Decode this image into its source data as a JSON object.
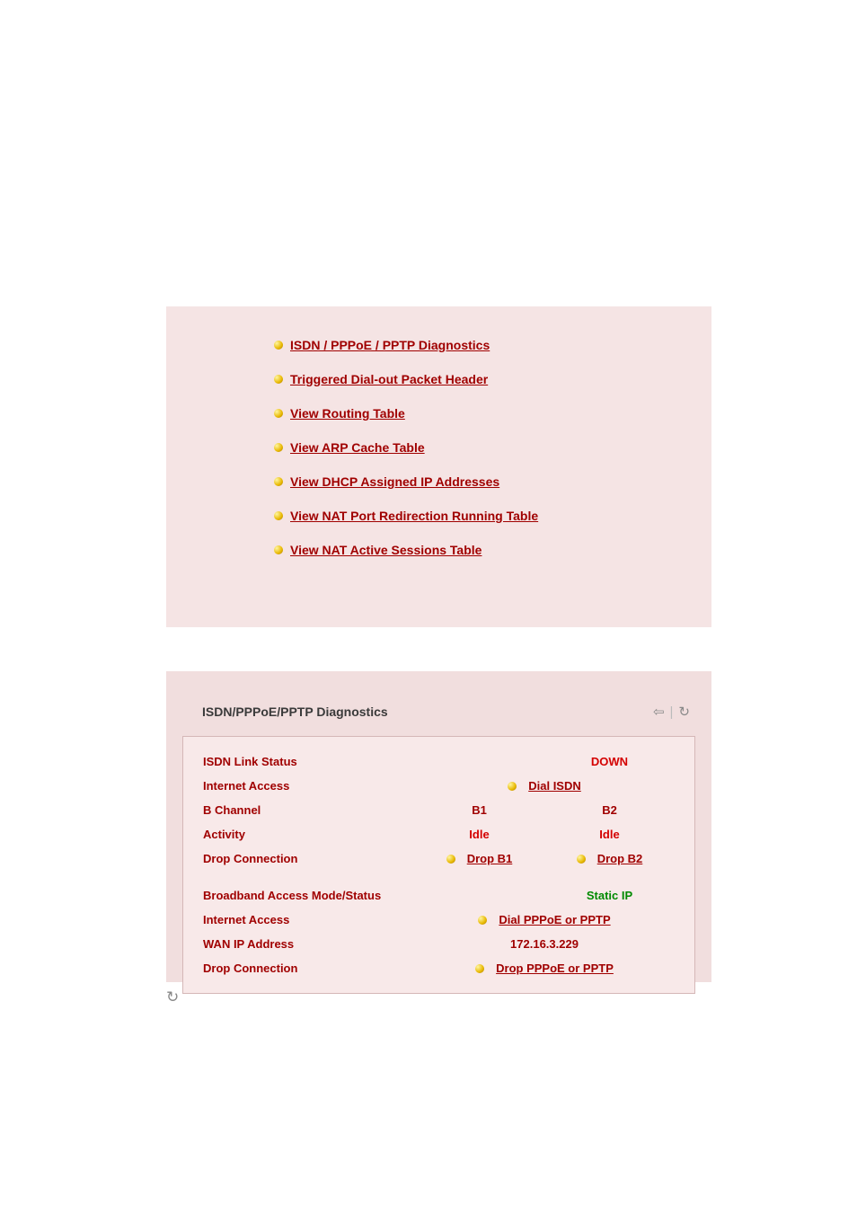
{
  "menu": {
    "items": [
      "ISDN / PPPoE / PPTP Diagnostics",
      "Triggered Dial-out Packet Header",
      "View Routing Table",
      "View ARP Cache Table",
      "View DHCP Assigned IP Addresses",
      "View NAT Port Redirection Running Table",
      "View NAT Active Sessions Table"
    ]
  },
  "diag": {
    "title": "ISDN/PPPoE/PPTP Diagnostics",
    "isdn": {
      "link_status_label": "ISDN Link Status",
      "link_status_value": "DOWN",
      "internet_access_label": "Internet Access",
      "dial_link": "Dial ISDN",
      "b_channel_label": "B Channel",
      "b1": "B1",
      "b2": "B2",
      "activity_label": "Activity",
      "activity_b1": "Idle",
      "activity_b2": "Idle",
      "drop_label": "Drop Connection",
      "drop_b1": "Drop B1",
      "drop_b2": "Drop B2"
    },
    "broadband": {
      "mode_label": "Broadband Access Mode/Status",
      "mode_value": "Static IP",
      "internet_access_label": "Internet Access",
      "dial_link": "Dial PPPoE or PPTP",
      "wan_ip_label": "WAN IP Address",
      "wan_ip_value": "172.16.3.229",
      "drop_label": "Drop Connection",
      "drop_link": "Drop PPPoE or PPTP"
    }
  },
  "icons": {
    "back": "⇦",
    "refresh": "↻"
  }
}
